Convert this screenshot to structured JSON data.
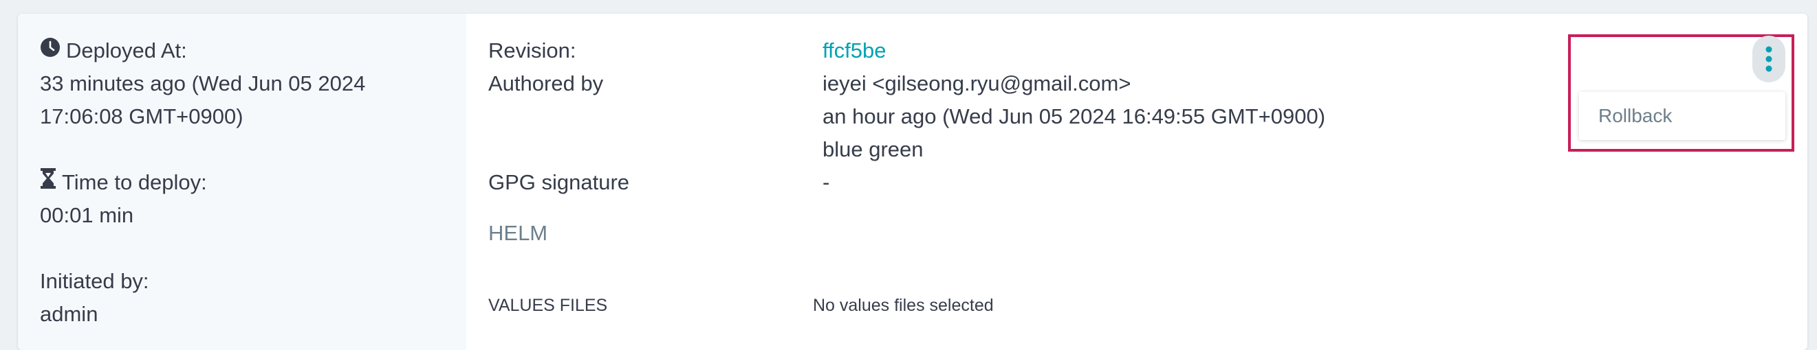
{
  "deploy": {
    "deployed_at_label": "Deployed At:",
    "deployed_at_line1": "33 minutes ago (Wed Jun 05 2024",
    "deployed_at_line2": "17:06:08 GMT+0900)",
    "time_to_deploy_label": "Time to deploy:",
    "time_to_deploy_value": "00:01 min",
    "initiated_by_label": "Initiated by:",
    "initiated_by_value": "admin"
  },
  "revision": {
    "label": "Revision:",
    "value": "ffcf5be"
  },
  "authored": {
    "label": "Authored by",
    "author": "ieyei <gilseong.ryu@gmail.com>",
    "time": "an hour ago (Wed Jun 05 2024 16:49:55 GMT+0900)",
    "message": "blue green"
  },
  "gpg": {
    "label": "GPG signature",
    "value": "-"
  },
  "helm": {
    "label": "HELM"
  },
  "values_files": {
    "label": "VALUES FILES",
    "value": "No values files selected"
  },
  "menu": {
    "rollback_label": "Rollback"
  },
  "colors": {
    "accent": "#00a2b3",
    "highlight_border": "#c81e5a"
  },
  "icons": {
    "deployed_at": "clock-icon",
    "time_to_deploy": "hourglass-icon",
    "menu": "kebab-menu-icon"
  }
}
